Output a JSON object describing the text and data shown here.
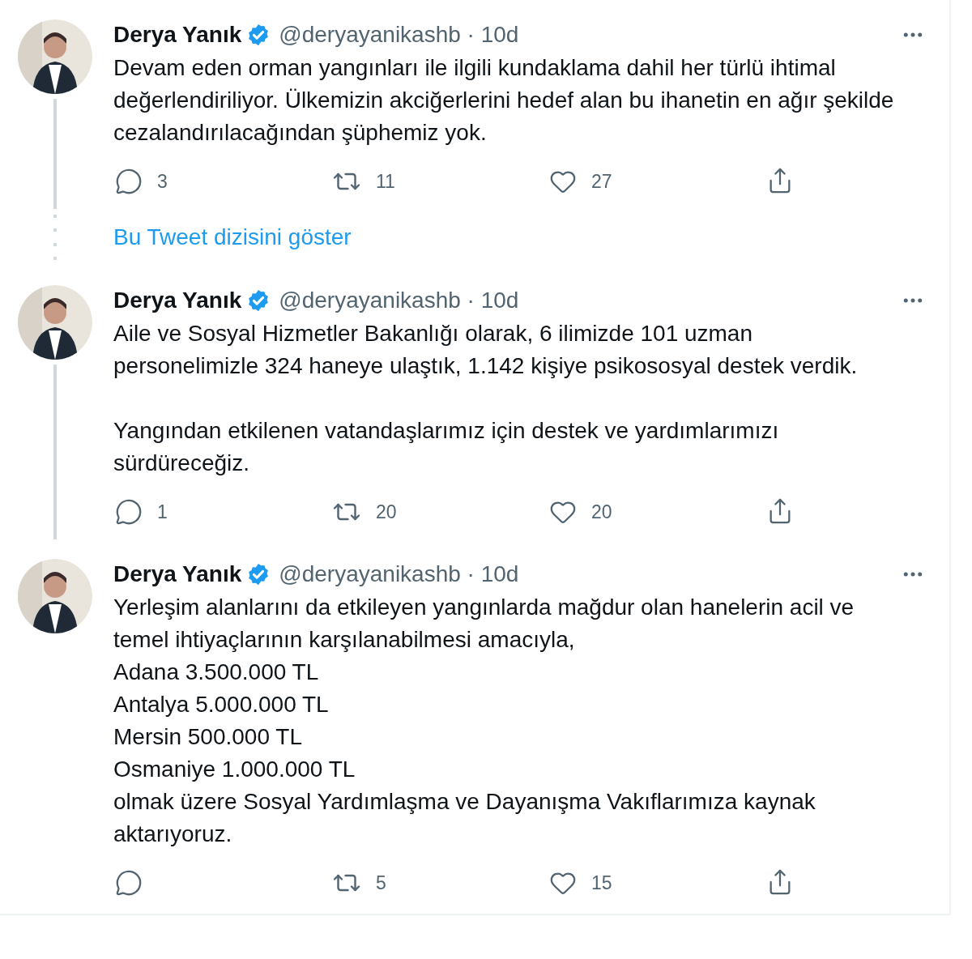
{
  "items": [
    {
      "kind": "tweet",
      "author": "Derya Yanık",
      "verified": true,
      "meta": "@deryayanikashb · 10d",
      "connected_below": true,
      "paragraphs": [
        "Devam eden orman yangınları ile ilgili kundaklama dahil her türlü ihtimal değerlendiriliyor. Ülkemizin akciğerlerini hedef alan bu ihanetin en ağır şekilde cezalandırılacağından şüphemiz yok."
      ],
      "replies": "3",
      "retweets": "11",
      "likes": "27"
    },
    {
      "kind": "show_thread",
      "label": "Bu Tweet dizisini göster"
    },
    {
      "kind": "tweet",
      "author": "Derya Yanık",
      "verified": true,
      "meta": "@deryayanikashb · 10d",
      "connected_below": true,
      "paragraphs": [
        "Aile ve Sosyal Hizmetler Bakanlığı olarak, 6 ilimizde 101 uzman personelimizle 324 haneye ulaştık, 1.142 kişiye psikososyal destek verdik.",
        "Yangından etkilenen vatandaşlarımız için destek ve yardımlarımızı sürdüreceğiz."
      ],
      "replies": "1",
      "retweets": "20",
      "likes": "20"
    },
    {
      "kind": "tweet",
      "author": "Derya Yanık",
      "verified": true,
      "meta": "@deryayanikashb · 10d",
      "connected_below": false,
      "paragraphs": [
        "Yerleşim alanlarını da etkileyen yangınlarda mağdur olan hanelerin acil ve temel ihtiyaçlarının karşılanabilmesi amacıyla,\nAdana 3.500.000 TL\nAntalya 5.000.000 TL\nMersin 500.000 TL\nOsmaniye 1.000.000 TL\nolmak üzere Sosyal Yardımlaşma ve Dayanışma Vakıflarımıza kaynak aktarıyoruz."
      ],
      "retweets": "5",
      "likes": "15"
    }
  ]
}
